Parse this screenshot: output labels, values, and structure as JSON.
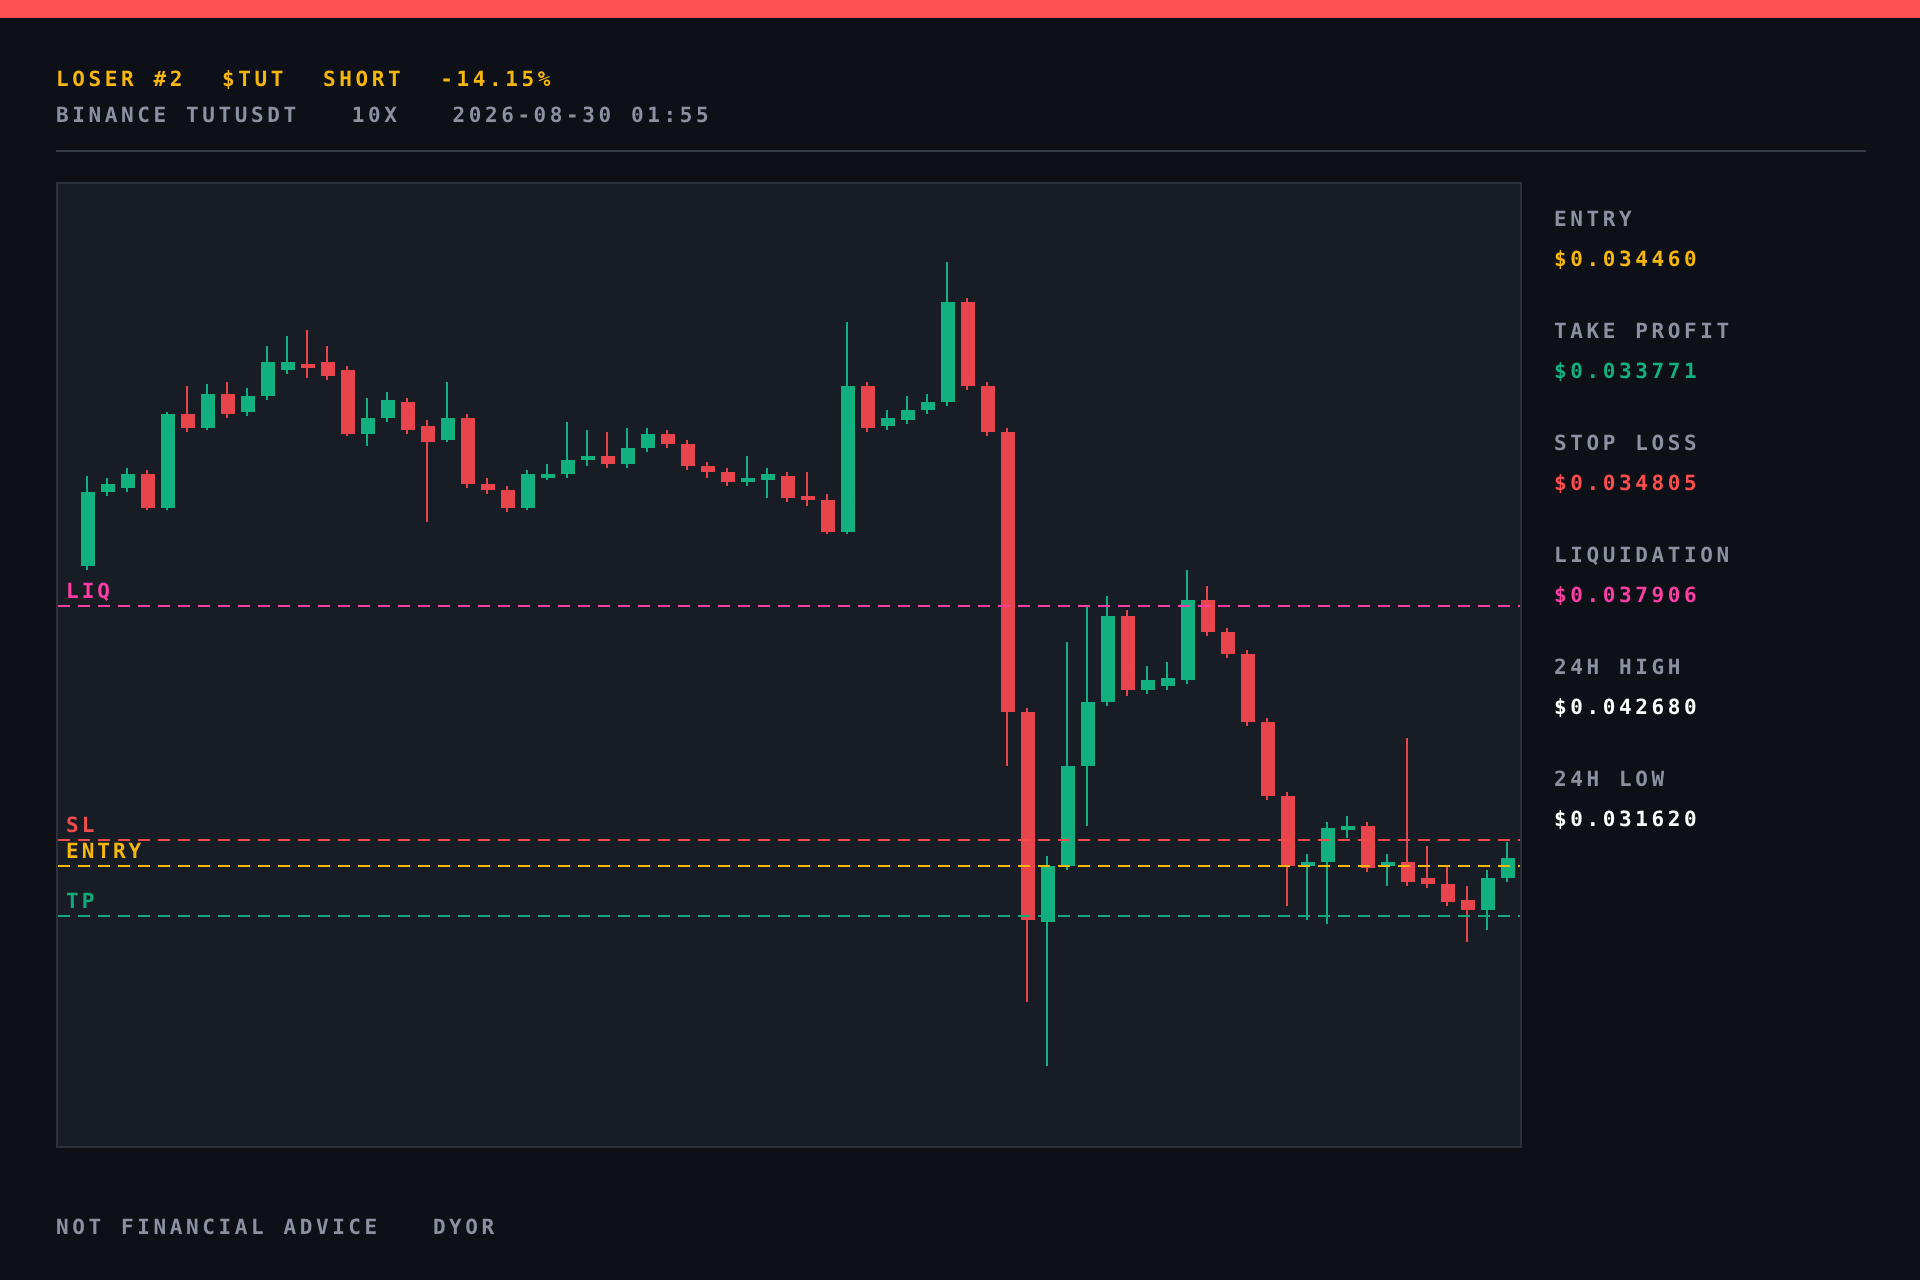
{
  "top_bar": {
    "color": "#ff5252"
  },
  "header": {
    "title": [
      "LOSER #2",
      "$TUT",
      "SHORT",
      "-14.15%"
    ],
    "subtitle": [
      "BINANCE TUTUSDT",
      "10X",
      "2026-08-30 01:55"
    ]
  },
  "chart": {
    "lines": [
      {
        "label": "LIQ",
        "color": "#ff3ea5"
      },
      {
        "label": "SL",
        "color": "#f04e4e"
      },
      {
        "label": "ENTRY",
        "color": "#f5b70b"
      },
      {
        "label": "TP",
        "color": "#12a97a"
      }
    ]
  },
  "stats": [
    {
      "label": "ENTRY",
      "value": "$0.034460",
      "color": "#f5b70b"
    },
    {
      "label": "TAKE PROFIT",
      "value": "$0.033771",
      "color": "#12b07e"
    },
    {
      "label": "STOP LOSS",
      "value": "$0.034805",
      "color": "#ff4d4d"
    },
    {
      "label": "LIQUIDATION",
      "value": "$0.037906",
      "color": "#ff3ea5"
    },
    {
      "label": "24H HIGH",
      "value": "$0.042680",
      "color": "#ffffff"
    },
    {
      "label": "24H LOW",
      "value": "$0.031620",
      "color": "#ffffff"
    }
  ],
  "footer": [
    "NOT FINANCIAL ADVICE",
    "DYOR"
  ]
}
